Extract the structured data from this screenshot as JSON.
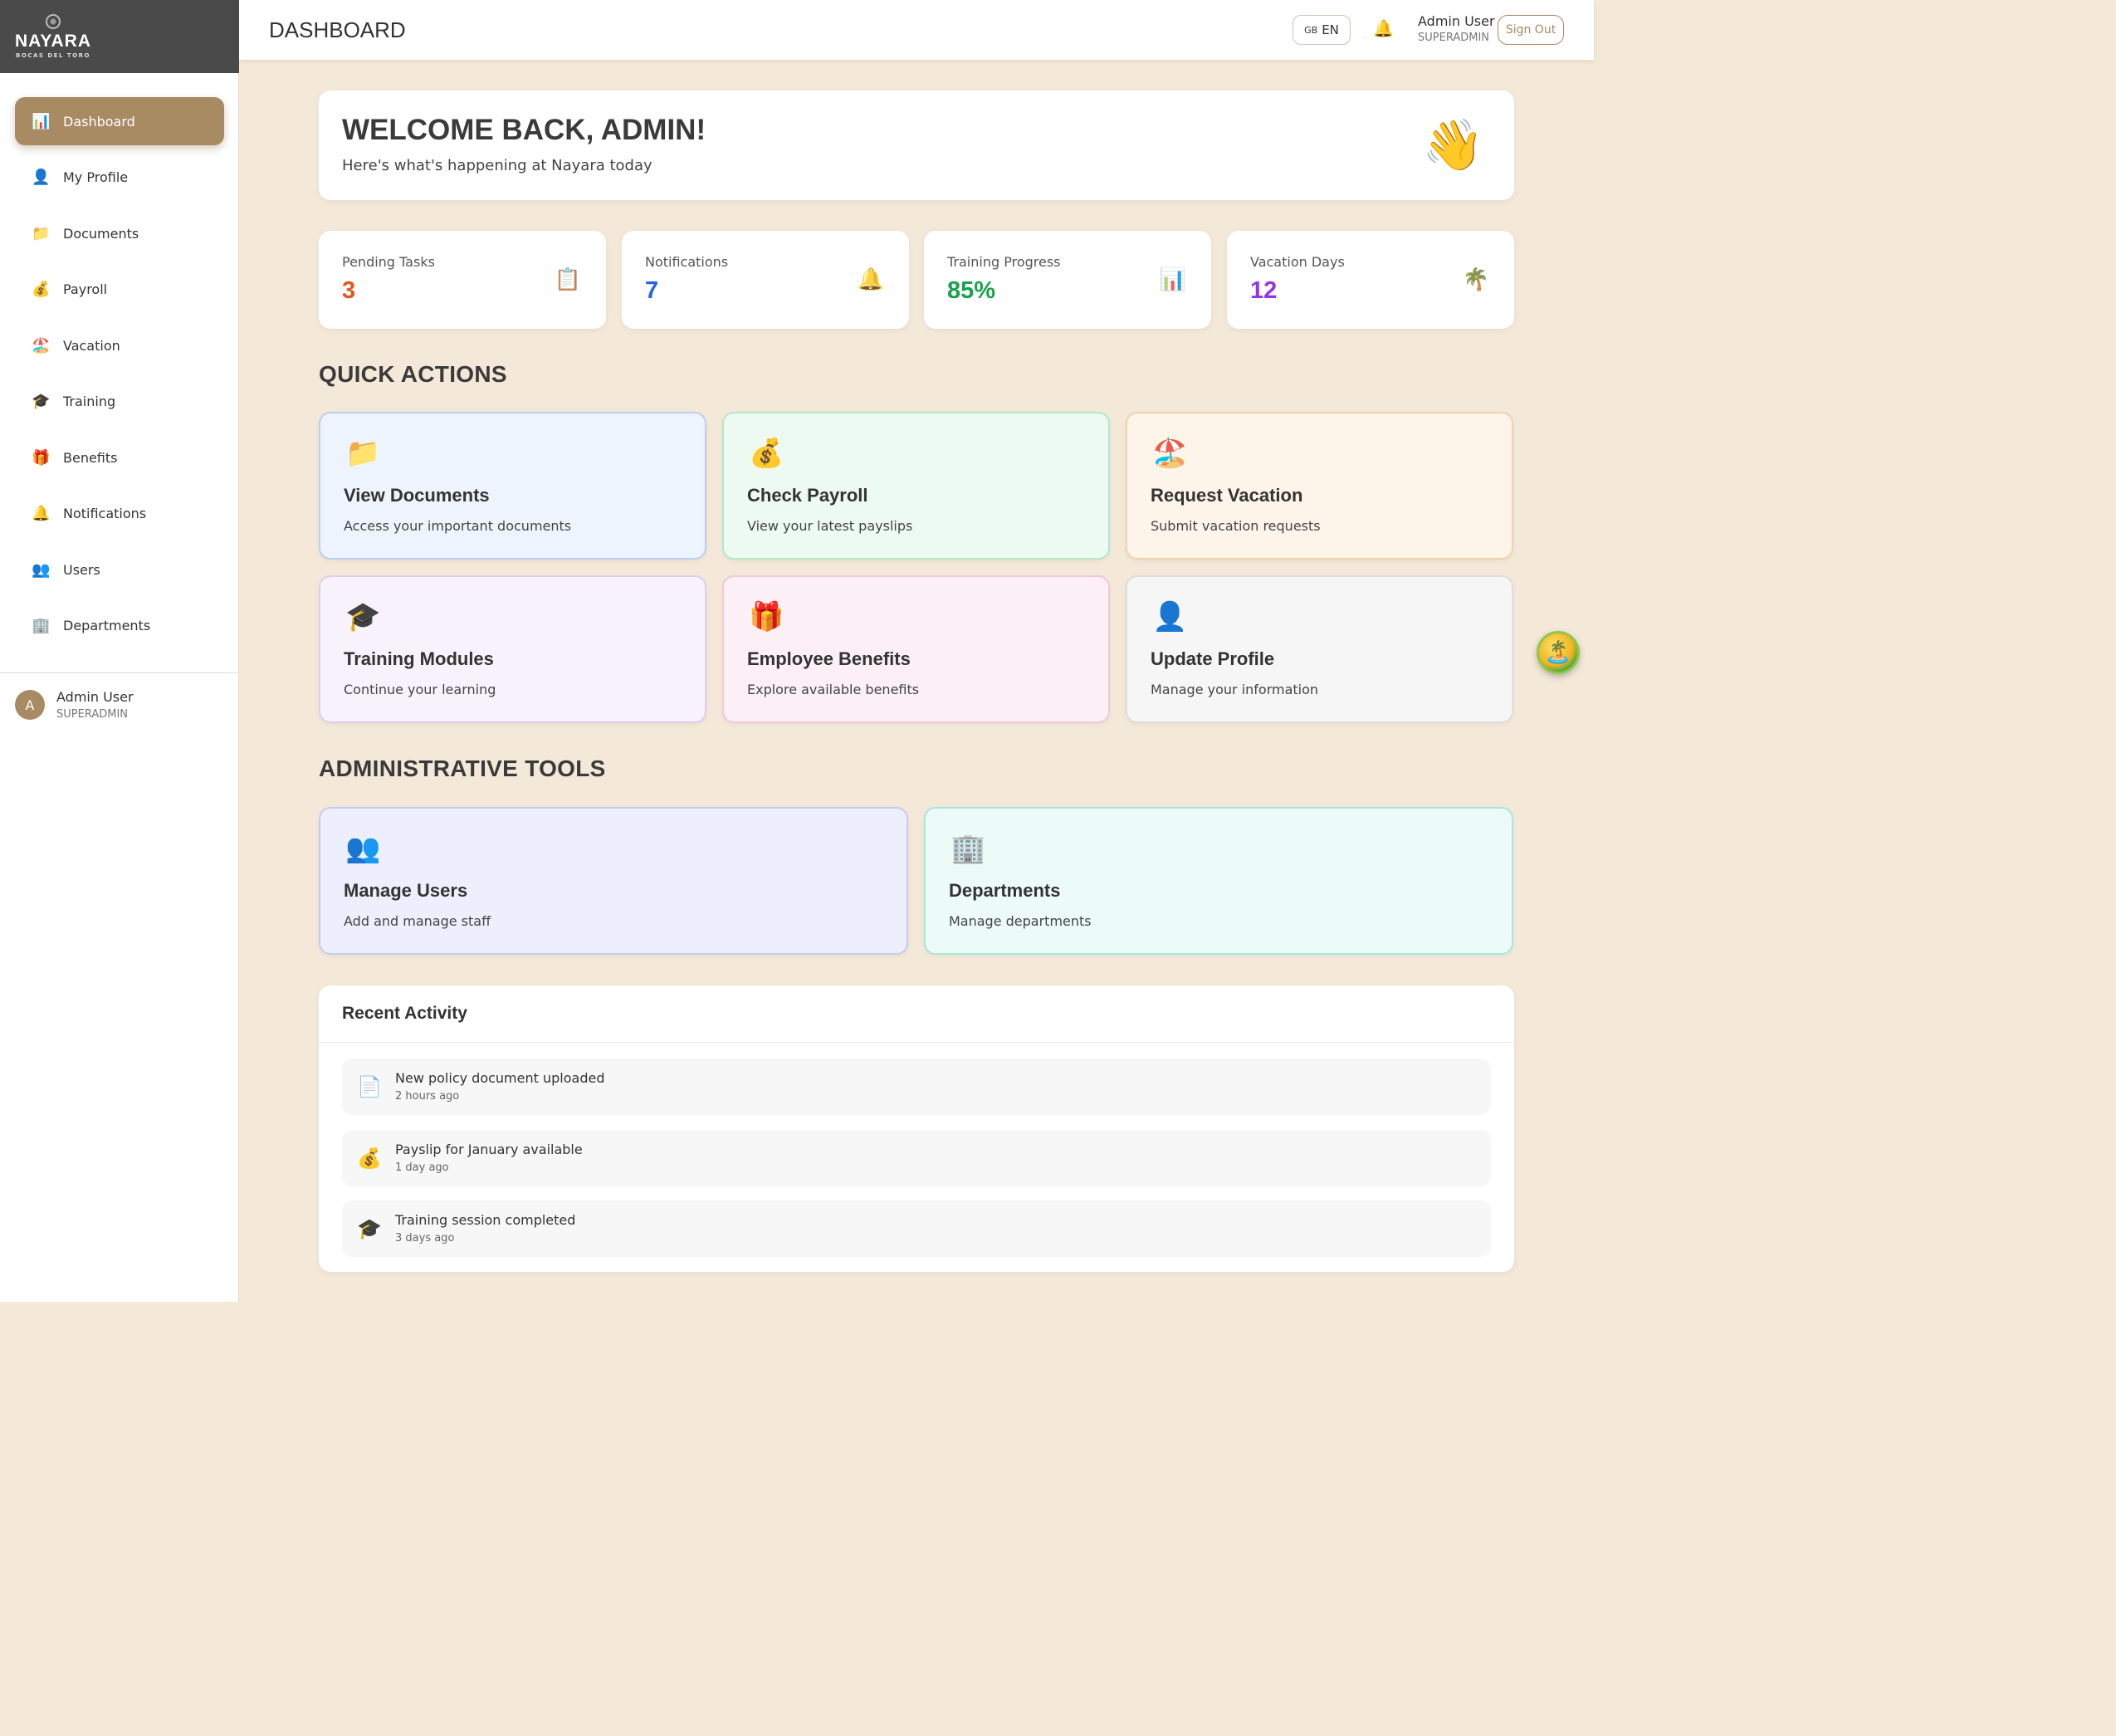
{
  "brand": {
    "name": "NAYARA",
    "tagline": "BOCAS DEL TORO"
  },
  "header": {
    "title": "DASHBOARD",
    "lang_flag": "GB",
    "lang_code": "EN",
    "user_name": "Admin User",
    "user_role": "SUPERADMIN",
    "sign_out": "Sign Out"
  },
  "sidebar": {
    "items": [
      {
        "label": "Dashboard",
        "icon": "📊",
        "active": true
      },
      {
        "label": "My Profile",
        "icon": "👤"
      },
      {
        "label": "Documents",
        "icon": "📁"
      },
      {
        "label": "Payroll",
        "icon": "💰"
      },
      {
        "label": "Vacation",
        "icon": "🏖️"
      },
      {
        "label": "Training",
        "icon": "🎓"
      },
      {
        "label": "Benefits",
        "icon": "🎁"
      },
      {
        "label": "Notifications",
        "icon": "🔔"
      },
      {
        "label": "Users",
        "icon": "👥"
      },
      {
        "label": "Departments",
        "icon": "🏢"
      }
    ],
    "user": {
      "initial": "A",
      "name": "Admin User",
      "role": "SUPERADMIN"
    }
  },
  "welcome": {
    "title": "WELCOME BACK, ADMIN!",
    "subtitle": "Here's what's happening at Nayara today",
    "icon": "👋"
  },
  "stats": [
    {
      "label": "Pending Tasks",
      "value": "3",
      "icon": "📋",
      "color": "#e0571c"
    },
    {
      "label": "Notifications",
      "value": "7",
      "icon": "🔔",
      "color": "#2563eb"
    },
    {
      "label": "Training Progress",
      "value": "85%",
      "icon": "📊",
      "color": "#16a34a"
    },
    {
      "label": "Vacation Days",
      "value": "12",
      "icon": "🌴",
      "color": "#9333ea"
    }
  ],
  "quick_actions": {
    "title": "QUICK ACTIONS",
    "cards": [
      {
        "title": "View Documents",
        "desc": "Access your important documents",
        "icon": "📁",
        "bg": "#eef4fd",
        "border": "#b9d0f0"
      },
      {
        "title": "Check Payroll",
        "desc": "View your latest payslips",
        "icon": "💰",
        "bg": "#ecfaf1",
        "border": "#b6e7c6"
      },
      {
        "title": "Request Vacation",
        "desc": "Submit vacation requests",
        "icon": "🏖️",
        "bg": "#fdf4ea",
        "border": "#f3d1ab"
      },
      {
        "title": "Training Modules",
        "desc": "Continue your learning",
        "icon": "🎓",
        "bg": "#f8f2fc",
        "border": "#dfcdef"
      },
      {
        "title": "Employee Benefits",
        "desc": "Explore available benefits",
        "icon": "🎁",
        "bg": "#fcf0f6",
        "border": "#f1c7dc"
      },
      {
        "title": "Update Profile",
        "desc": "Manage your information",
        "icon": "👤",
        "bg": "#f6f6f6",
        "border": "#dedede"
      }
    ]
  },
  "admin_tools": {
    "title": "ADMINISTRATIVE TOOLS",
    "cards": [
      {
        "title": "Manage Users",
        "desc": "Add and manage staff",
        "icon": "👥",
        "bg": "#edf0fc",
        "border": "#c4cdf1"
      },
      {
        "title": "Departments",
        "desc": "Manage departments",
        "icon": "🏢",
        "bg": "#ecfbf8",
        "border": "#a8e8dc"
      }
    ]
  },
  "recent_activity": {
    "title": "Recent Activity",
    "items": [
      {
        "text": "New policy document uploaded",
        "time": "2 hours ago",
        "icon": "📄"
      },
      {
        "text": "Payslip for January available",
        "time": "1 day ago",
        "icon": "💰"
      },
      {
        "text": "Training session completed",
        "time": "3 days ago",
        "icon": "🎓"
      }
    ]
  },
  "floating_button": {
    "icon": "🏝️"
  }
}
